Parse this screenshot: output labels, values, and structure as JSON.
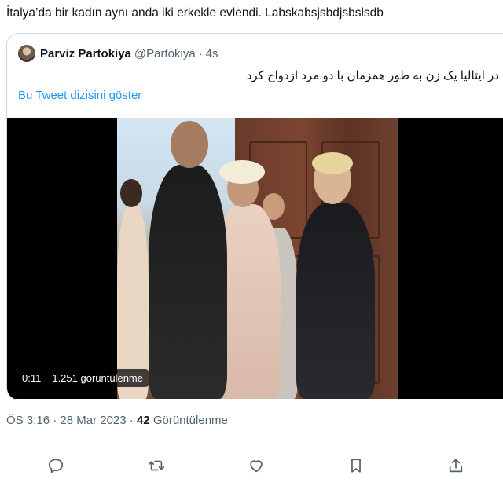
{
  "tweet": {
    "text": "İtalya’da bir kadın aynı anda iki erkekle evlendi. Labskabsjsbdjsbslsdb"
  },
  "quoted": {
    "name": "Parviz Partokiya",
    "handle": "@Partokiya",
    "dot": "·",
    "time": "4s",
    "text": "در ایتالیا یک زن به طور همزمان با دو مرد ازدواج کرد",
    "thread_link": "Bu Tweet dizisini göster",
    "video": {
      "timestamp": "0:11",
      "views": "1.251 görüntülenme"
    }
  },
  "meta": {
    "time": "ÖS 3:16",
    "sep1": "·",
    "date": "28 Mar 2023",
    "sep2": "·",
    "views_count": "42",
    "views_label": "Görüntülenme"
  },
  "actions": [
    "reply-icon",
    "retweet-icon",
    "like-icon",
    "bookmark-icon",
    "share-icon"
  ]
}
